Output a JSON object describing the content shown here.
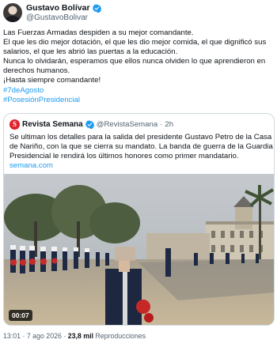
{
  "author": {
    "display_name": "Gustavo Bolívar",
    "handle": "@GustavoBolivar",
    "avatar_icon": "profile-photo",
    "verified_icon": "verified-badge-icon",
    "verified_color": "#1d9bf0"
  },
  "tweet": {
    "lines": [
      "Las Fuerzas Armadas despiden a su mejor comandante.",
      "El que les dio mejor dotación, el que les dio mejor comida, el que dignificó sus",
      "salarios, el que les abrió las puertas a la educación.",
      "Nunca lo olvidarán, esperamos que ellos nunca olviden lo que aprendieron en",
      "derechos humanos.",
      "¡Hasta siempre comandante!"
    ],
    "hashtags": [
      "#7deAgosto",
      "#PosesiónPresidencial"
    ],
    "link_color": "#1d9bf0"
  },
  "quote": {
    "logo_letter": "S",
    "logo_color": "#e0202a",
    "display_name": "Revista Semana",
    "handle": "@RevistaSemana",
    "separator": "·",
    "time": "2h",
    "lines": [
      "Se ultiman los detalles para la salida del presidente Gustavo Petro de la Casa",
      "de Nariño, con la que se cierra su mandato. La banda de guerra de la Guardia",
      "Presidencial le rendirá los últimos honores como primer mandatario."
    ],
    "link": "semana.com",
    "video": {
      "timestamp": "00:07"
    }
  },
  "meta": {
    "time": "13:01",
    "date_separator": " · ",
    "date": "7 ago 2026",
    "views_separator": " · ",
    "views_count": "23,8 mil",
    "views_label": " Reproducciones"
  }
}
